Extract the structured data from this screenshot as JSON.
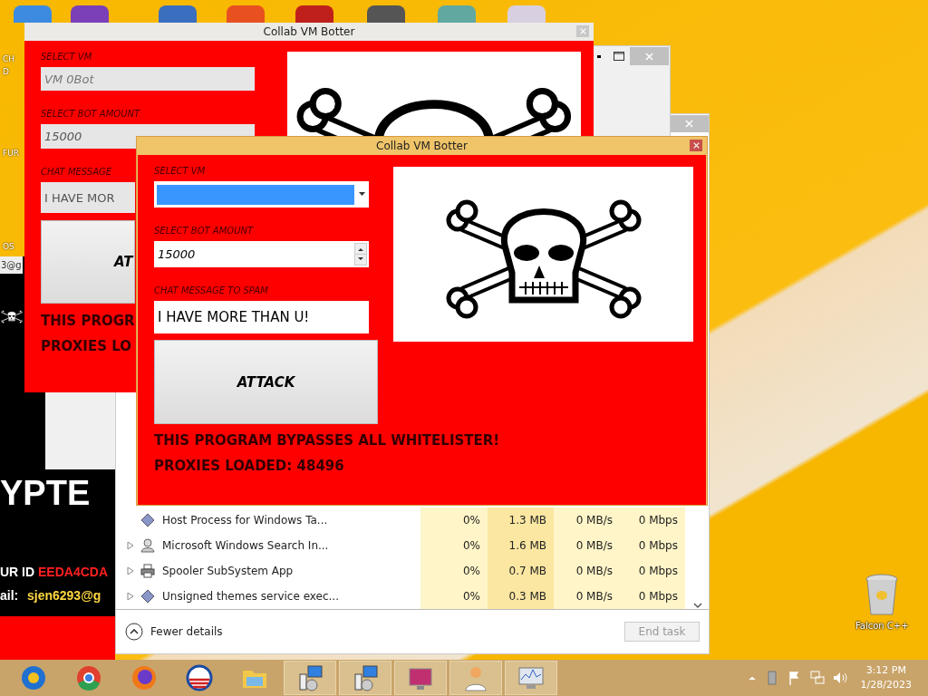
{
  "desktop_labels": [
    "CH",
    "D",
    "FUR",
    "OS"
  ],
  "ransom_note": {
    "email_fragment": "3@g",
    "headline": "YPTE",
    "id_label": "UR ID",
    "id_value": "EEDA4CDA",
    "email_label": "ail:",
    "email_value": "sjen6293@g"
  },
  "back_window": {
    "title": "Collab VM Botter",
    "vm_label": "SELECT VM",
    "vm_field": {
      "value": "VM 0Bot",
      "disabled": true
    },
    "bot_label": "SELECT BOT AMOUNT",
    "bot_value": "15000",
    "chat_label": "CHAT MESSAGE",
    "chat_value": "I HAVE MOR",
    "attack": "AT",
    "line_1": "THIS PROGR",
    "line_2": "PROXIES LO"
  },
  "task_manager": {
    "rows": [
      {
        "name": "Host Process for Windows Ta...",
        "expandable": false,
        "kind": "diamond",
        "cpu": "0%",
        "memory": "1.3 MB",
        "disk": "0 MB/s",
        "network": "0 Mbps"
      },
      {
        "name": "Microsoft Windows Search In...",
        "expandable": true,
        "kind": "person",
        "cpu": "0%",
        "memory": "1.6 MB",
        "disk": "0 MB/s",
        "network": "0 Mbps"
      },
      {
        "name": "Spooler SubSystem App",
        "expandable": true,
        "kind": "printer",
        "cpu": "0%",
        "memory": "0.7 MB",
        "disk": "0 MB/s",
        "network": "0 Mbps"
      },
      {
        "name": "Unsigned themes service exec...",
        "expandable": true,
        "kind": "diamond",
        "cpu": "0%",
        "memory": "0.3 MB",
        "disk": "0 MB/s",
        "network": "0 Mbps"
      }
    ],
    "footer_toggle": "Fewer details",
    "end_task": {
      "label": "End task",
      "disabled": true
    }
  },
  "front_window": {
    "title": "Collab VM Botter",
    "vm_label": "SELECT VM",
    "vm_field": {
      "highlighted": true
    },
    "bot_label": "SELECT BOT AMOUNT",
    "bot_value": "15000",
    "chat_label": "CHAT MESSAGE TO SPAM",
    "chat_value": "I HAVE MORE THAN U!",
    "attack": "ATTACK",
    "line_1": "THIS PROGRAM BYPASSES ALL WHITELISTER!",
    "line_2": "PROXIES LOADED: 48496"
  },
  "recycle_bin": {
    "label": "Falcon C++"
  },
  "taskbar": {
    "apps": [
      {
        "kind": "globe",
        "running": false
      },
      {
        "kind": "browser",
        "running": false
      },
      {
        "kind": "fox",
        "running": false
      },
      {
        "kind": "stripes",
        "running": false
      },
      {
        "kind": "folder",
        "running": false
      },
      {
        "kind": "installer",
        "running": true
      },
      {
        "kind": "installer",
        "running": true
      },
      {
        "kind": "screen",
        "running": true
      },
      {
        "kind": "person",
        "running": true
      },
      {
        "kind": "monitor",
        "running": true
      }
    ],
    "time": "3:12 PM",
    "date": "1/28/2023"
  }
}
